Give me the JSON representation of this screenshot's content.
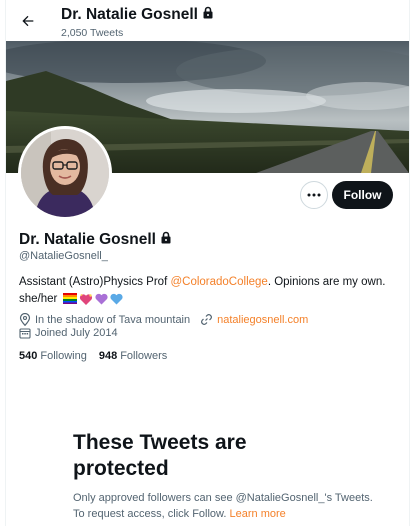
{
  "header": {
    "name": "Dr. Natalie Gosnell",
    "tweet_count": "2,050 Tweets"
  },
  "actions": {
    "follow_label": "Follow"
  },
  "profile": {
    "name": "Dr. Natalie Gosnell",
    "handle": "@NatalieGosnell_",
    "bio_text": "Assistant (Astro)Physics Prof ",
    "bio_link": "@ColoradoCollege",
    "bio_text2": ". Opinions are my own.",
    "bio_line2": "she/her",
    "emojis": [
      "rainbow-flag",
      "heart-pink-sparkle",
      "purple-heart",
      "blue-heart"
    ],
    "location": "In the shadow of Tava mountain",
    "website": "nataliegosnell.com",
    "joined": "Joined July 2014"
  },
  "stats": {
    "following_count": "540",
    "following_label": "Following",
    "followers_count": "948",
    "followers_label": "Followers"
  },
  "protected": {
    "title_line1": "These Tweets are",
    "title_line2": "protected",
    "body": "Only approved followers can see @NatalieGosnell_'s Tweets. To request access, click Follow. ",
    "learn_more": "Learn more"
  },
  "colors": {
    "accent": "#f4812a",
    "follow_button": "#0f1419",
    "secondary_text": "#536471"
  }
}
